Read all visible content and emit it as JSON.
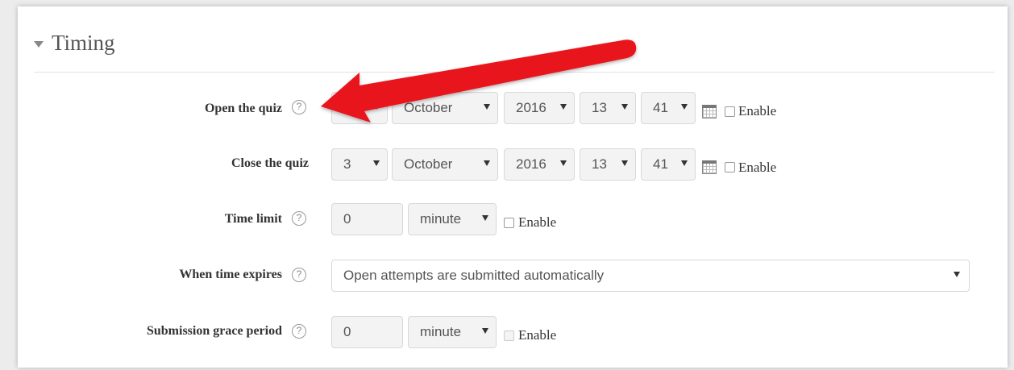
{
  "section": {
    "title": "Timing"
  },
  "rows": {
    "open": {
      "label": "Open the quiz",
      "day": "",
      "month": "October",
      "year": "2016",
      "hour": "13",
      "minute": "41",
      "enable": "Enable"
    },
    "close": {
      "label": "Close the quiz",
      "day": "3",
      "month": "October",
      "year": "2016",
      "hour": "13",
      "minute": "41",
      "enable": "Enable"
    },
    "timelimit": {
      "label": "Time limit",
      "value": "0",
      "unit": "minute",
      "enable": "Enable"
    },
    "expires": {
      "label": "When time expires",
      "value": "Open attempts are submitted automatically"
    },
    "grace": {
      "label": "Submission grace period",
      "value": "0",
      "unit": "minute",
      "enable": "Enable"
    }
  },
  "icons": {
    "help": "question-mark-circle-icon",
    "calendar": "calendar-icon",
    "collapse": "triangle-down-icon"
  },
  "colors": {
    "arrow": "#e8141b"
  }
}
